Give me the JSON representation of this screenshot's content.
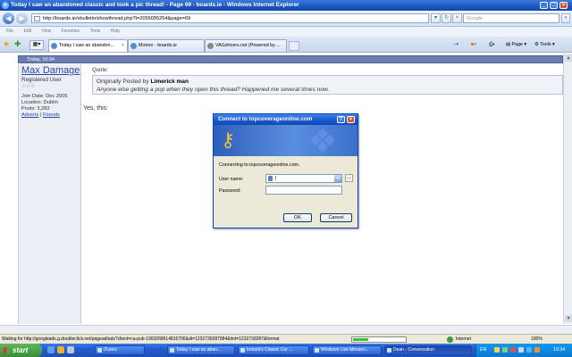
{
  "window": {
    "title": "Today I saw an abandoned classic and took a pic thread! - Page 69 - boards.ie - Windows Internet Explorer"
  },
  "address_bar": {
    "url": "http://boards.ie/vbulletin/showthread.php?t=2055095254&page=69",
    "search_placeholder": "Google"
  },
  "menu": [
    "File",
    "Edit",
    "View",
    "Favorites",
    "Tools",
    "Help"
  ],
  "tabs": [
    {
      "label": "Today I saw an abandon...",
      "active": true
    },
    {
      "label": "Motoro - boards.ie",
      "active": false
    },
    {
      "label": "VAGdrivers.net (Powered by ...",
      "active": false
    }
  ],
  "toolbar": {
    "page_label": "Page",
    "tools_label": "Tools"
  },
  "post": {
    "date": "Today, 19:34",
    "username": "Max Damage",
    "user_title": "Registered User",
    "stars": "☆☆☆",
    "join_date": "Join Date: Dec 2005",
    "location": "Location: Dublin",
    "posts": "Posts: 3,282",
    "links": {
      "adverts": "Adverts",
      "separator": " | ",
      "friends": "Friends"
    },
    "quote_label": "Quote:",
    "quote_prefix": "Originally Posted by ",
    "quote_author": "Limerick man",
    "quote_text": "Anyone else getting a pop when they open this thread? Happened me several times now.",
    "body": "Yes, this:"
  },
  "dialog": {
    "title": "Connect to topcoverageonline.com",
    "connecting_text": "Connecting to topcoverageonline.com.",
    "username_label": "User name:",
    "username_value": "|",
    "password_label": "Password:",
    "ok_label": "OK",
    "cancel_label": "Cancel"
  },
  "status_bar": {
    "text": "Waiting for http://googleads.g.doubleclick.net/pagead/ads?client=ca-pub-1903268614816706&dt=1232739287984&lmt=1232739287&format",
    "zone": "Internet",
    "zoom": "100%",
    "progress_fraction": 0.3
  },
  "taskbar": {
    "start_label": "start",
    "tasks": [
      {
        "label": "iTunes",
        "active": false
      },
      {
        "label": "Today I saw an aban...",
        "active": false
      },
      {
        "label": "Ireland's Classic Car ...",
        "active": false
      },
      {
        "label": "Windows Live Messen...",
        "active": false
      },
      {
        "label": "Dean - Conversation",
        "active": true
      }
    ],
    "language": "EN",
    "clock": "19:34"
  },
  "colors": {
    "title_blue": "#1c55c4",
    "post_header": "#6a7fb0",
    "username_link": "#2a47a8",
    "start_green": "#388e38"
  }
}
